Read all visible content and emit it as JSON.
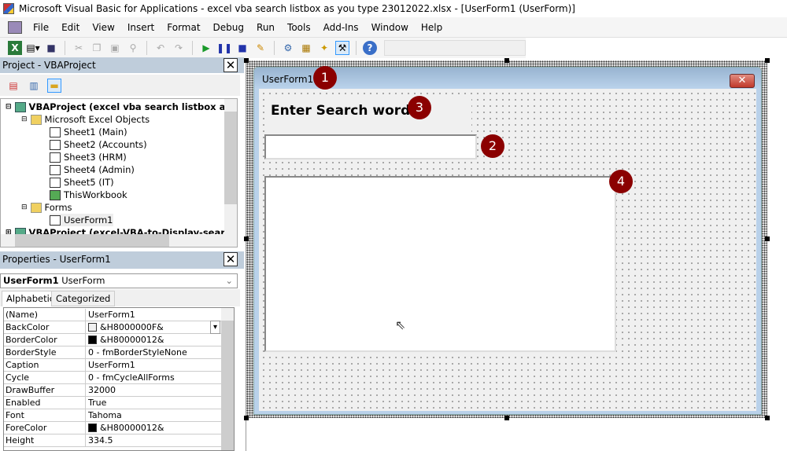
{
  "window": {
    "title": "Microsoft Visual Basic for Applications - excel vba search listbox as you type 23012022.xlsx - [UserForm1 (UserForm)]"
  },
  "menu": [
    "File",
    "Edit",
    "View",
    "Insert",
    "Format",
    "Debug",
    "Run",
    "Tools",
    "Add-Ins",
    "Window",
    "Help"
  ],
  "project": {
    "title": "Project - VBAProject",
    "nodes": [
      {
        "label": "VBAProject (excel vba search listbox as yo",
        "bold": true
      },
      {
        "label": "Microsoft Excel Objects"
      },
      {
        "label": "Sheet1 (Main)"
      },
      {
        "label": "Sheet2 (Accounts)"
      },
      {
        "label": "Sheet3 (HRM)"
      },
      {
        "label": "Sheet4 (Admin)"
      },
      {
        "label": "Sheet5 (IT)"
      },
      {
        "label": "ThisWorkbook"
      },
      {
        "label": "Forms"
      },
      {
        "label": "UserForm1"
      },
      {
        "label": "VBAProject (excel-VBA-to-Display-search-",
        "bold": true
      }
    ]
  },
  "properties": {
    "title": "Properties - UserForm1",
    "object_name": "UserForm1",
    "object_type": "UserForm",
    "tabs": [
      "Alphabetic",
      "Categorized"
    ],
    "rows": [
      {
        "k": "(Name)",
        "v": "UserForm1"
      },
      {
        "k": "BackColor",
        "v": "&H8000000F&",
        "swatch": "#f0f0f0"
      },
      {
        "k": "BorderColor",
        "v": "&H80000012&",
        "swatch": "#000000"
      },
      {
        "k": "BorderStyle",
        "v": "0 - fmBorderStyleNone"
      },
      {
        "k": "Caption",
        "v": "UserForm1"
      },
      {
        "k": "Cycle",
        "v": "0 - fmCycleAllForms"
      },
      {
        "k": "DrawBuffer",
        "v": "32000"
      },
      {
        "k": "Enabled",
        "v": "True"
      },
      {
        "k": "Font",
        "v": "Tahoma"
      },
      {
        "k": "ForeColor",
        "v": "&H80000012&",
        "swatch": "#000000"
      },
      {
        "k": "Height",
        "v": "334.5"
      }
    ]
  },
  "form": {
    "caption": "UserForm1",
    "close_label": "✕",
    "label_text": "Enter Search word",
    "textbox_value": "",
    "badges": [
      "1",
      "2",
      "3",
      "4"
    ],
    "badge_color": "#8b0000"
  }
}
